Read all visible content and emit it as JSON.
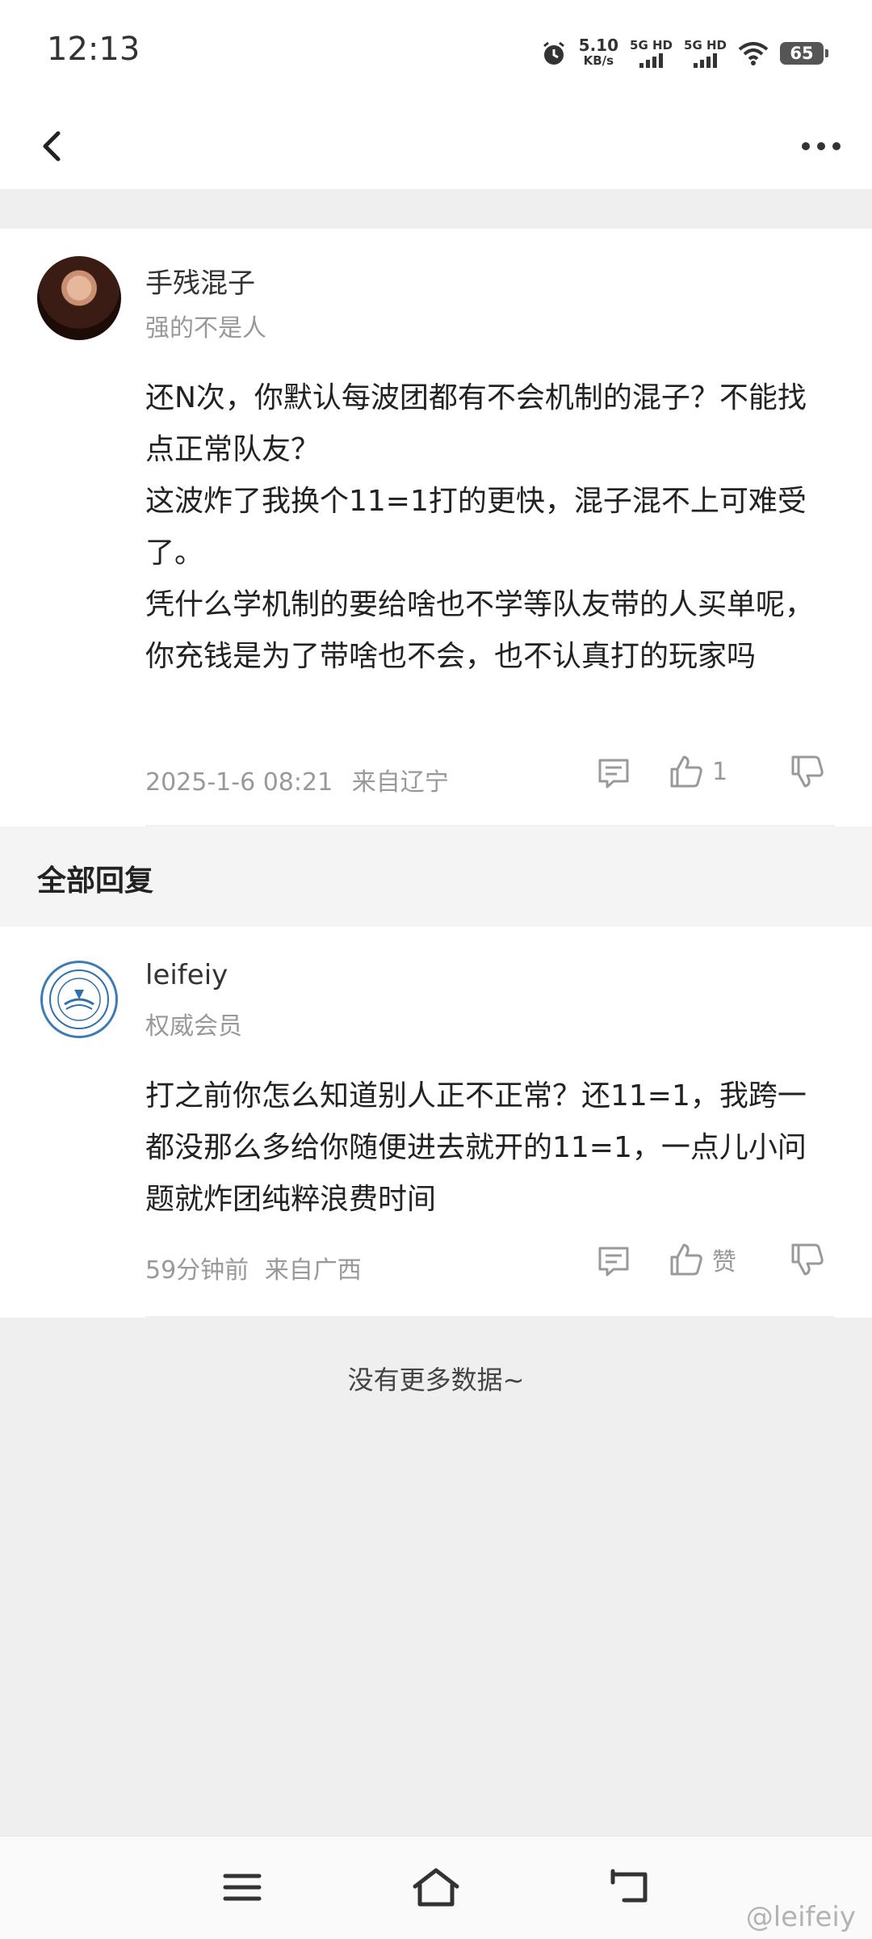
{
  "status_bar": {
    "time": "12:13",
    "net_speed_value": "5.10",
    "net_speed_unit": "KB/s",
    "signal_1_label": "5G HD",
    "signal_2_label": "5G HD",
    "battery": "65"
  },
  "post": {
    "username": "手残混子",
    "user_title": "强的不是人",
    "content": [
      "还N次，你默认每波团都有不会机制的混子？不能找点正常队友？",
      "这波炸了我换个11=1打的更快，混子混不上可难受了。",
      "凭什么学机制的要给啥也不学等队友带的人买单呢，你充钱是为了带啥也不会，也不认真打的玩家吗"
    ],
    "timestamp": "2025-1-6 08:21",
    "location": "来自辽宁",
    "like_count": "1"
  },
  "replies_section": {
    "title": "全部回复"
  },
  "reply": {
    "username": "leifeiy",
    "user_title": "权威会员",
    "content": "打之前你怎么知道别人正不正常？还11=1，我跨一都没那么多给你随便进去就开的11=1，一点儿小问题就炸团纯粹浪费时间",
    "timestamp": "59分钟前",
    "location": "来自广西",
    "like_label": "赞"
  },
  "footer": {
    "no_more": "没有更多数据~"
  },
  "watermark": "@leifeiy",
  "colors": {
    "background": "#efefef",
    "card": "#ffffff",
    "meta_text": "#999999"
  }
}
